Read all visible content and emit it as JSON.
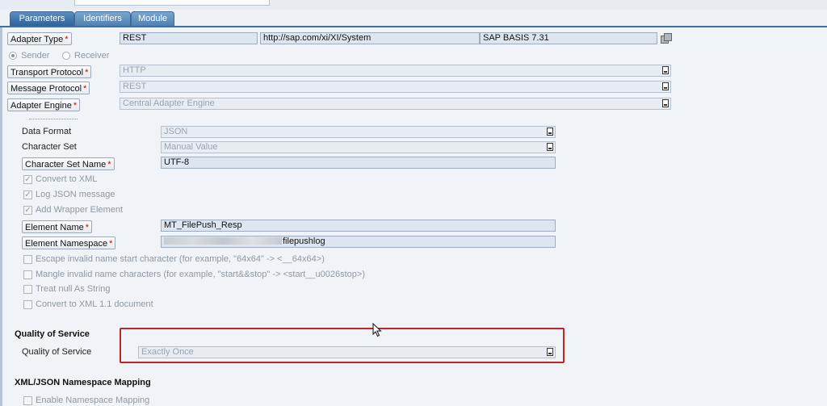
{
  "tabs": [
    {
      "label": "Parameters",
      "active": true
    },
    {
      "label": "Identifiers",
      "active": false
    },
    {
      "label": "Module",
      "active": false
    }
  ],
  "adapter": {
    "type_label": "Adapter Type",
    "type_value": "REST",
    "namespace_value": "http://sap.com/xi/XI/System",
    "swcv_value": "SAP BASIS 7.31",
    "sender_label": "Sender",
    "receiver_label": "Receiver",
    "direction_selected": "Sender",
    "transport_protocol_label": "Transport Protocol",
    "transport_protocol_value": "HTTP",
    "message_protocol_label": "Message Protocol",
    "message_protocol_value": "REST",
    "adapter_engine_label": "Adapter Engine",
    "adapter_engine_value": "Central Adapter Engine"
  },
  "format": {
    "data_format_label": "Data Format",
    "data_format_value": "JSON",
    "charset_label": "Character Set",
    "charset_value": "Manual Value",
    "charset_name_label": "Character Set Name",
    "charset_name_value": "UTF-8",
    "convert_xml_label": "Convert to XML",
    "log_json_label": "Log JSON message",
    "wrapper_label": "Add Wrapper Element",
    "element_name_label": "Element Name",
    "element_name_value": "MT_FilePush_Resp",
    "element_ns_label": "Element Namespace",
    "element_ns_value_visible": "filepushlog",
    "escape_label": "Escape invalid name start character (for example, \"64x64\" -> <__64x64>)",
    "mangle_label": "Mangle invalid name characters (for example, \"start&&stop\" -> <start__u0026stop>)",
    "null_label": "Treat null As String",
    "xml11_label": "Convert to XML 1.1 document"
  },
  "qos": {
    "section_title": "Quality of Service",
    "label": "Quality of Service",
    "value": "Exactly Once"
  },
  "ns_mapping": {
    "section_title": "XML/JSON Namespace Mapping",
    "enable_label": "Enable Namespace Mapping"
  },
  "colors": {
    "tab_active": "#2f6399",
    "tab_inactive": "#4f80b2",
    "highlight_box": "#c02525",
    "required_asterisk": "#cc0000"
  }
}
